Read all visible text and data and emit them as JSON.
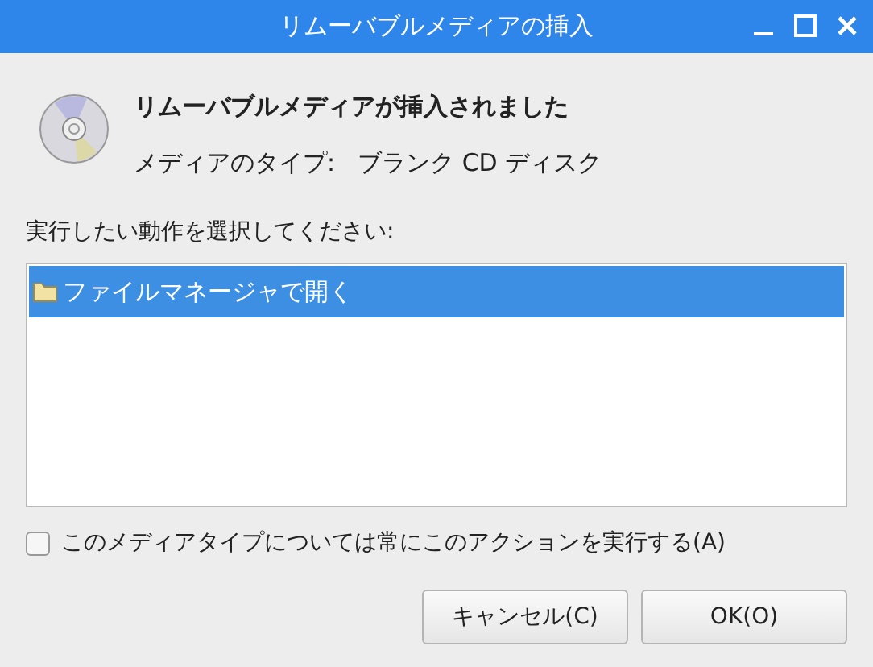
{
  "window": {
    "title": "リムーバブルメディアの挿入"
  },
  "header": {
    "heading": "リムーバブルメディアが挿入されました",
    "media_label": "メディアのタイプ:",
    "media_type": "ブランク CD ディスク"
  },
  "prompt": "実行したい動作を選択してください:",
  "actions": [
    {
      "label": "ファイルマネージャで開く",
      "selected": true
    }
  ],
  "always_checkbox": {
    "label": "このメディアタイプについては常にこのアクションを実行する(A)",
    "checked": false
  },
  "buttons": [
    {
      "label": "キャンセル(C)"
    },
    {
      "label": "OK(O)"
    }
  ]
}
